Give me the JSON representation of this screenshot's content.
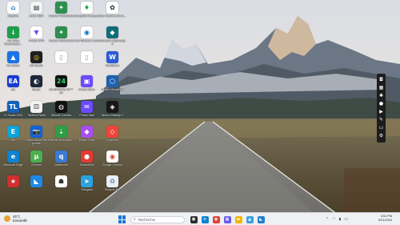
{
  "desktop_icons": [
    {
      "label": "Graphite",
      "icon": "graphite-icon",
      "color": "#ffffff",
      "fg": "#2b6cb0",
      "glyph": "⌂"
    },
    {
      "label": "editor 2024",
      "icon": "editor-icon",
      "color": "#f4f4f4",
      "fg": "#333",
      "glyph": "▤"
    },
    {
      "label": "Crystal Fiddlesticks",
      "icon": "crystal-icon",
      "color": "#2d8f4e",
      "fg": "#fff",
      "glyph": "✦"
    },
    {
      "label": "MongoDB Compass",
      "icon": "mongodb-icon",
      "color": "#ffffff",
      "fg": "#13aa52",
      "glyph": "♦"
    },
    {
      "label": "Velo Interface Anim...",
      "icon": "velo-icon",
      "color": "#ffffff",
      "fg": "#222",
      "glyph": "✿"
    },
    {
      "label": "AE Video Downloader...",
      "icon": "ae-video-icon",
      "color": "#1e9e4a",
      "fg": "#fff",
      "glyph": "↓"
    },
    {
      "label": "Proton VPN",
      "icon": "proton-vpn-icon",
      "color": "#ffffff",
      "fg": "#6d4aff",
      "glyph": "▼"
    },
    {
      "label": "Crystal Fiddlesticks",
      "icon": "crystal-icon-2",
      "color": "#2d8f4e",
      "fg": "#fff",
      "glyph": "✦"
    },
    {
      "label": "Intel Wireless Tasks",
      "icon": "intel-icon",
      "color": "#ffffff",
      "fg": "#0071c5",
      "glyph": "◉"
    },
    {
      "label": "Microsoft Clipchamp 2",
      "icon": "clipchamp-icon",
      "color": "#0f6d7a",
      "fg": "#fff",
      "glyph": "◆"
    },
    {
      "label": "Vlc Codec",
      "icon": "vlc-icon",
      "color": "#1a73e8",
      "fg": "#fff",
      "glyph": "▲"
    },
    {
      "label": "OS Studio",
      "icon": "os-studio-icon",
      "color": "#1f1f1f",
      "fg": "#f5c518",
      "glyph": "◎"
    },
    {
      "label": "",
      "icon": "document-icon",
      "color": "#ffffff",
      "fg": "#999",
      "glyph": "▯"
    },
    {
      "label": "",
      "icon": "document-icon-2",
      "color": "#ffffff",
      "fg": "#999",
      "glyph": "▯"
    },
    {
      "label": "WebStorm",
      "icon": "webstorm-icon",
      "color": "#2a5bd7",
      "fg": "#fff",
      "glyph": "W"
    },
    {
      "label": "EA",
      "icon": "ea-icon",
      "color": "#1a3bd0",
      "fg": "#fff",
      "glyph": "EA"
    },
    {
      "label": "Steam",
      "icon": "steam-icon",
      "color": "#1b2838",
      "fg": "#fff",
      "glyph": "◐"
    },
    {
      "label": "EA SPORTS FC™ 24",
      "icon": "easports-icon",
      "color": "#101010",
      "fg": "#2cd96b",
      "glyph": "24"
    },
    {
      "label": "Proton Drive",
      "icon": "proton-drive-icon",
      "color": "#6d4aff",
      "fg": "#fff",
      "glyph": "▣"
    },
    {
      "label": "Oracle VirtualBox",
      "icon": "virtualbox-icon",
      "color": "#1e63b0",
      "fg": "#fff",
      "glyph": "⬡"
    },
    {
      "label": "TL Studio 2021",
      "icon": "tl-studio-icon",
      "color": "#1560bd",
      "fg": "#fff",
      "glyph": "TL"
    },
    {
      "label": "Tasteful Patrol",
      "icon": "tasteful-icon",
      "color": "#f2f2f2",
      "fg": "#555",
      "glyph": "⚄"
    },
    {
      "label": "Ubisoft Connect",
      "icon": "ubisoft-icon",
      "color": "#111111",
      "fg": "#fff",
      "glyph": "◍"
    },
    {
      "label": "Proton Mail",
      "icon": "proton-mail-icon",
      "color": "#6d4aff",
      "fg": "#fff",
      "glyph": "✉"
    },
    {
      "label": "Nexus Desktop 2",
      "icon": "nexus-icon",
      "color": "#181818",
      "fg": "#fff",
      "glyph": "◈"
    },
    {
      "label": "Elk",
      "icon": "elk-icon",
      "color": "#0aa5d9",
      "fg": "#fff",
      "glyph": "E"
    },
    {
      "label": "Learn about this picture",
      "icon": "spotlight-icon",
      "color": "#0f62d6",
      "fg": "#fff",
      "glyph": "📷"
    },
    {
      "label": "Internet Download...",
      "icon": "idm-icon",
      "color": "#2f9e44",
      "fg": "#fff",
      "glyph": "⇣"
    },
    {
      "label": "Proton Pass",
      "icon": "proton-pass-icon",
      "color": "#a84ef7",
      "fg": "#fff",
      "glyph": "◆"
    },
    {
      "label": "AnyDesk",
      "icon": "anydesk-icon",
      "color": "#ef443b",
      "fg": "#fff",
      "glyph": "◇"
    },
    {
      "label": "Microsoft Edge",
      "icon": "edge-icon",
      "color": "#0f82d0",
      "fg": "#fff",
      "glyph": "e"
    },
    {
      "label": "uTorrent",
      "icon": "utorrent-icon",
      "color": "#4caf50",
      "fg": "#fff",
      "glyph": "µ"
    },
    {
      "label": "Qbittorrent",
      "icon": "qbittorrent-icon",
      "color": "#3a7bd5",
      "fg": "#fff",
      "glyph": "q"
    },
    {
      "label": "ScreenRec",
      "icon": "screenrec-icon",
      "color": "#e53935",
      "fg": "#fff",
      "glyph": "●"
    },
    {
      "label": "Google Chrome",
      "icon": "chrome-icon",
      "color": "#ffffff",
      "fg": "#db4437",
      "glyph": "◉"
    },
    {
      "label": "",
      "icon": "app-red-icon",
      "color": "#d32f2f",
      "fg": "#fff",
      "glyph": "★"
    },
    {
      "label": "",
      "icon": "app-blue-icon",
      "color": "#1e88e5",
      "fg": "#fff",
      "glyph": "◣"
    },
    {
      "label": "",
      "icon": "app-white-icon",
      "color": "#ffffff",
      "fg": "#333",
      "glyph": "☗"
    },
    {
      "label": "Telegram",
      "icon": "telegram-icon",
      "color": "#2aa3e0",
      "fg": "#fff",
      "glyph": "➤"
    },
    {
      "label": "Recycle Bin",
      "icon": "recycle-bin-icon",
      "color": "#e6eef6",
      "fg": "#6b7c8f",
      "glyph": "♻"
    }
  ],
  "side_toolbar": [
    "camera-icon",
    "grid-icon",
    "settings-icon",
    "mic-icon",
    "video-icon",
    "pen-icon",
    "monitor-icon",
    "gear-icon"
  ],
  "taskbar": {
    "weather_temp": "45°C",
    "weather_desc": "Ensoleillé",
    "search_placeholder": "Rechercher",
    "apps": [
      {
        "icon": "task-view-icon",
        "color": "#2b2b2b",
        "glyph": "▣"
      },
      {
        "icon": "edge-taskbar-icon",
        "color": "#0f82d0",
        "glyph": "e"
      },
      {
        "icon": "chrome-taskbar-icon",
        "color": "#db4437",
        "glyph": "◉"
      },
      {
        "icon": "store-taskbar-icon",
        "color": "#6b5ce7",
        "glyph": "▦"
      },
      {
        "icon": "explorer-taskbar-icon",
        "color": "#f2b705",
        "glyph": "▬"
      },
      {
        "icon": "photos-taskbar-icon",
        "color": "#3aa0e0",
        "glyph": "▲"
      },
      {
        "icon": "vscode-taskbar-icon",
        "color": "#1e7fd3",
        "glyph": "◣"
      }
    ],
    "tray_icons": [
      "chevron-up-icon",
      "wifi-icon",
      "volume-icon",
      "battery-icon"
    ],
    "clock_time": "3:51 PM",
    "clock_date": "5/21/2024"
  }
}
